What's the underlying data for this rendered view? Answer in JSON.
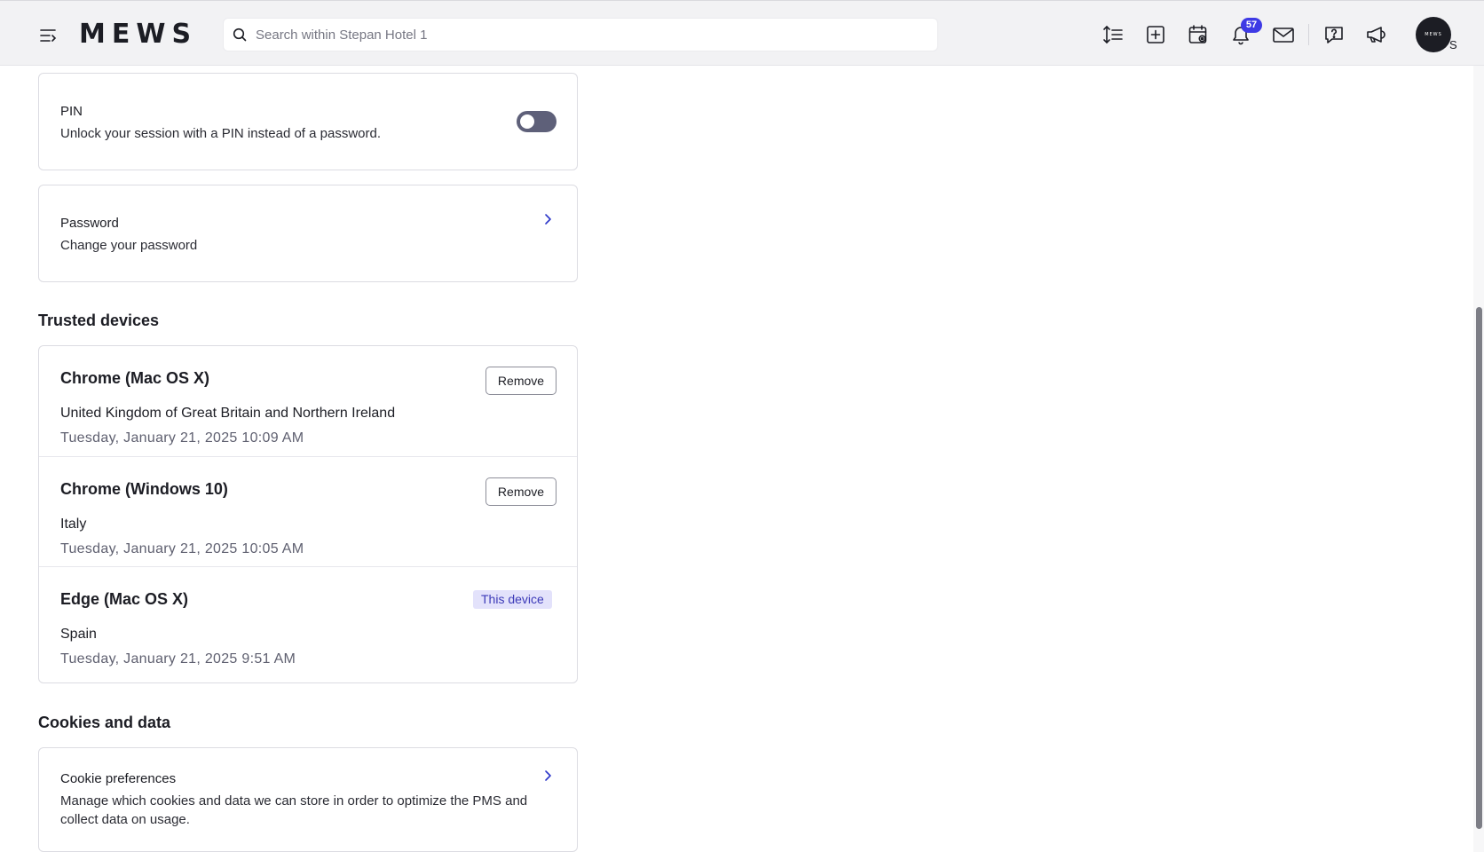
{
  "topbar": {
    "logo": "MEWS",
    "search_placeholder": "Search within Stepan Hotel 1",
    "notification_count": "57",
    "avatar_text": "MEWS",
    "avatar_initial": "S"
  },
  "security": {
    "pin": {
      "title": "PIN",
      "description": "Unlock your session with a PIN instead of a password.",
      "enabled": false
    },
    "password": {
      "title": "Password",
      "description": "Change your password"
    }
  },
  "trusted_devices": {
    "heading": "Trusted devices",
    "remove_label": "Remove",
    "this_device_label": "This device",
    "devices": [
      {
        "name": "Chrome (Mac OS X)",
        "location": "United Kingdom of Great Britain and Northern Ireland",
        "time": "Tuesday, January 21, 2025 10:09 AM"
      },
      {
        "name": "Chrome (Windows 10)",
        "location": "Italy",
        "time": "Tuesday, January 21, 2025 10:05 AM"
      },
      {
        "name": "Edge (Mac OS X)",
        "location": "Spain",
        "time": "Tuesday, January 21, 2025 9:51 AM"
      }
    ]
  },
  "cookies": {
    "heading": "Cookies and data",
    "title": "Cookie preferences",
    "description": "Manage which cookies and data we can store in order to optimize the PMS and collect data on usage."
  },
  "icons": {
    "menu": "menu-collapse-icon",
    "search": "search-icon",
    "sort": "line-spacing-icon",
    "add": "plus-square-icon",
    "calendar": "calendar-view-icon",
    "bell": "bell-icon",
    "mail": "mail-icon",
    "help": "help-chat-icon",
    "announcements": "megaphone-icon",
    "chevron": "chevron-right-icon"
  },
  "colors": {
    "accent": "#3e3ae5",
    "toggle_off": "#5e6079",
    "this_device_bg": "#e3e2fb"
  }
}
